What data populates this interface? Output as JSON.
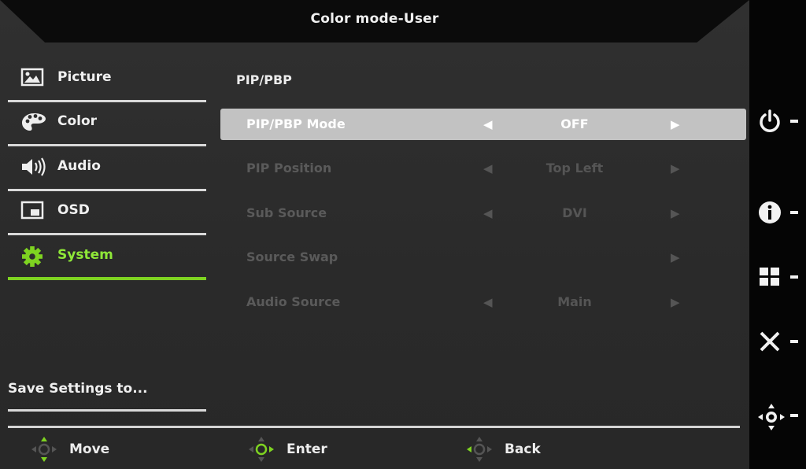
{
  "window": {
    "title": "Color mode-User"
  },
  "sidebar": {
    "items": [
      {
        "label": "Picture",
        "icon": "picture-icon",
        "active": false
      },
      {
        "label": "Color",
        "icon": "palette-icon",
        "active": false
      },
      {
        "label": "Audio",
        "icon": "speaker-icon",
        "active": false
      },
      {
        "label": "OSD",
        "icon": "osd-window-icon",
        "active": false
      },
      {
        "label": "System",
        "icon": "gear-icon",
        "active": true
      }
    ],
    "save_settings": "Save Settings to..."
  },
  "main": {
    "section_title": "PIP/PBP",
    "rows": [
      {
        "label": "PIP/PBP Mode",
        "left_arrow": "◀",
        "value": "OFF",
        "right_arrow": "▶",
        "selected": true
      },
      {
        "label": "PIP Position",
        "left_arrow": "◀",
        "value": "Top Left",
        "right_arrow": "▶",
        "selected": false
      },
      {
        "label": "Sub Source",
        "left_arrow": "◀",
        "value": "DVI",
        "right_arrow": "▶",
        "selected": false
      },
      {
        "label": "Source Swap",
        "left_arrow": "",
        "value": "",
        "right_arrow": "▶",
        "selected": false
      },
      {
        "label": "Audio Source",
        "left_arrow": "◀",
        "value": "Main",
        "right_arrow": "▶",
        "selected": false
      }
    ]
  },
  "footer": {
    "hints": [
      {
        "label": "Move",
        "icon": "dpad-updown-icon"
      },
      {
        "label": "Enter",
        "icon": "dpad-enter-icon"
      },
      {
        "label": "Back",
        "icon": "dpad-back-icon"
      }
    ]
  },
  "hotkeys": [
    {
      "icon": "power-icon"
    },
    {
      "icon": "info-icon"
    },
    {
      "icon": "grid-icon"
    },
    {
      "icon": "close-icon"
    },
    {
      "icon": "joystick-icon"
    }
  ],
  "colors": {
    "accent": "#7ed321",
    "selected_row": "#c2c2c2",
    "background": "#2b2b2b",
    "side_panel": "#050505"
  }
}
